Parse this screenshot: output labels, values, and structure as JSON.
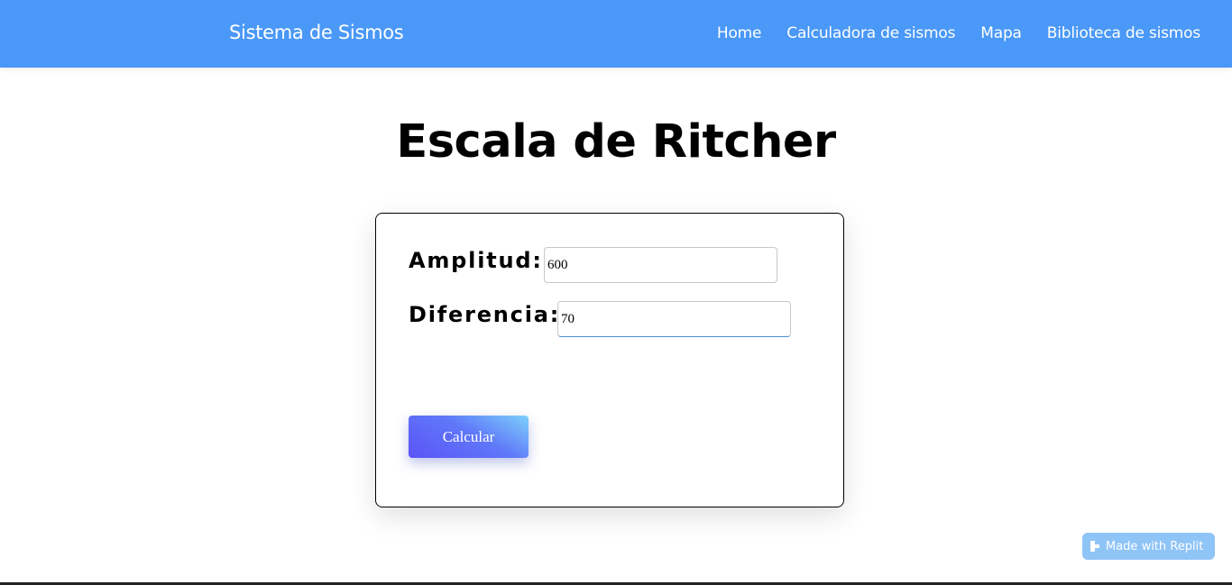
{
  "navbar": {
    "brand": "Sistema de Sismos",
    "links": [
      {
        "label": "Home"
      },
      {
        "label": "Calculadora de sismos"
      },
      {
        "label": "Mapa"
      },
      {
        "label": "Biblioteca de sismos"
      }
    ],
    "background_color": "#4a98f7"
  },
  "main": {
    "title": "Escala de Ritcher",
    "form": {
      "amplitud": {
        "label": "Amplitud:",
        "value": "600"
      },
      "diferencia": {
        "label": "Diferencia:",
        "value": "70"
      },
      "submit_label": "Calcular"
    }
  },
  "badge": {
    "label": "Made with Replit",
    "icon": "replit-icon"
  }
}
